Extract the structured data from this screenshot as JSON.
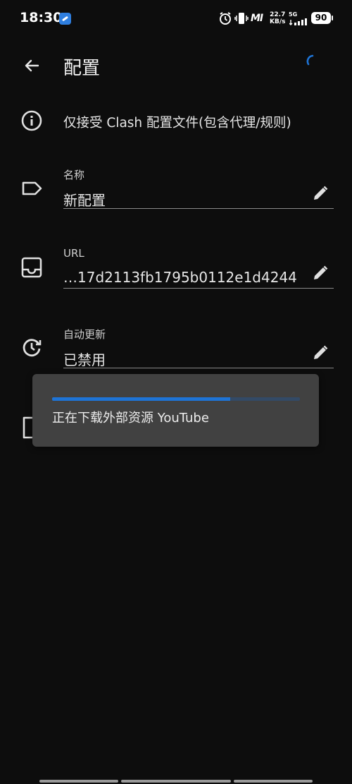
{
  "status_bar": {
    "time": "18:30",
    "carrier_mark": "MI",
    "speed_value": "22.7",
    "speed_unit": "KB/s",
    "network": "5G",
    "battery": "90",
    "icons": [
      "app-icon",
      "alarm-icon",
      "vibrate-icon",
      "signal-icon",
      "battery-icon"
    ]
  },
  "header": {
    "title": "配置"
  },
  "info": {
    "text": "仅接受 Clash 配置文件(包含代理/规则)"
  },
  "fields": {
    "name": {
      "label": "名称",
      "value": "新配置"
    },
    "url": {
      "label": "URL",
      "value": "…17d2113fb1795b0112e1d4244"
    },
    "auto_update": {
      "label": "自动更新",
      "value": "已禁用"
    }
  },
  "toast": {
    "text": "正在下载外部资源 YouTube",
    "progress": 0.72
  },
  "colors": {
    "accent": "#1e74d6",
    "background": "#0d0d0d",
    "card": "#414141"
  }
}
